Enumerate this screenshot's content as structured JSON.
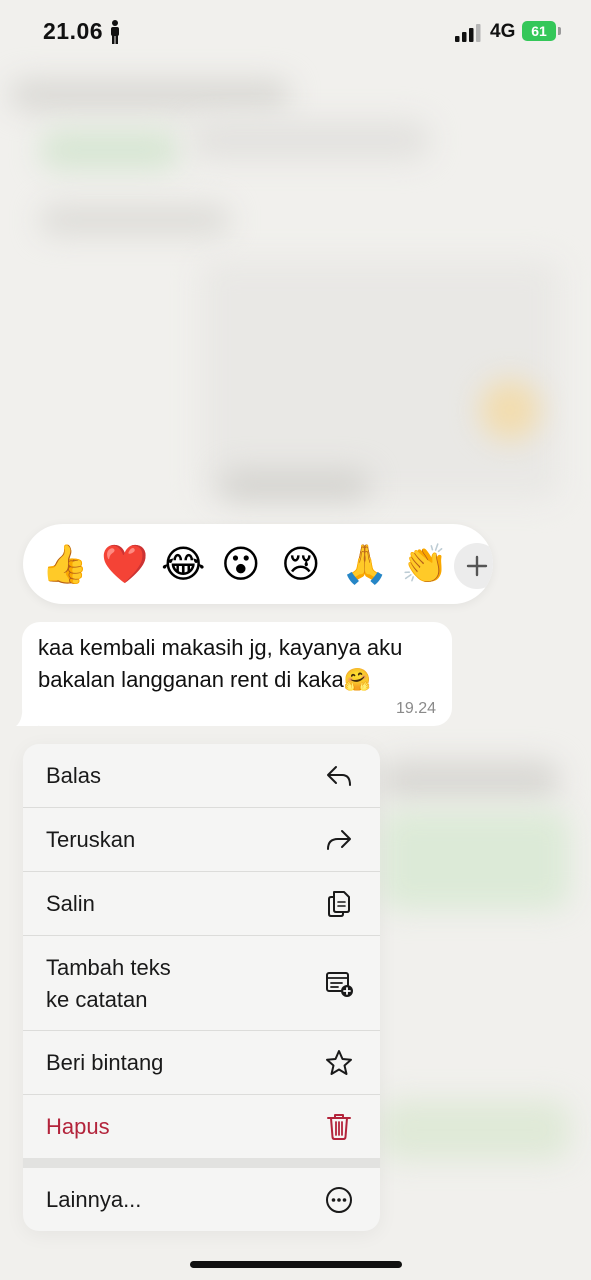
{
  "status_bar": {
    "time": "21.06",
    "network": "4G",
    "battery": "61"
  },
  "reactions": {
    "emojis": [
      "👍",
      "❤️",
      "😂",
      "😮",
      "😢",
      "🙏",
      "👏"
    ],
    "more_icon": "plus-icon"
  },
  "message": {
    "text": "kaa kembali makasih jg, kayanya aku bakalan langganan rent di kaka🤗",
    "time": "19.24"
  },
  "menu": {
    "items": [
      {
        "label": "Balas",
        "icon": "reply-icon"
      },
      {
        "label": "Teruskan",
        "icon": "forward-icon"
      },
      {
        "label": "Salin",
        "icon": "copy-icon"
      },
      {
        "label": "Tambah teks\nke catatan",
        "icon": "add-note-icon"
      },
      {
        "label": "Beri bintang",
        "icon": "star-icon"
      },
      {
        "label": "Hapus",
        "icon": "trash-icon",
        "color": "#b3243b"
      },
      {
        "label": "Lainnya...",
        "icon": "more-icon"
      }
    ]
  }
}
